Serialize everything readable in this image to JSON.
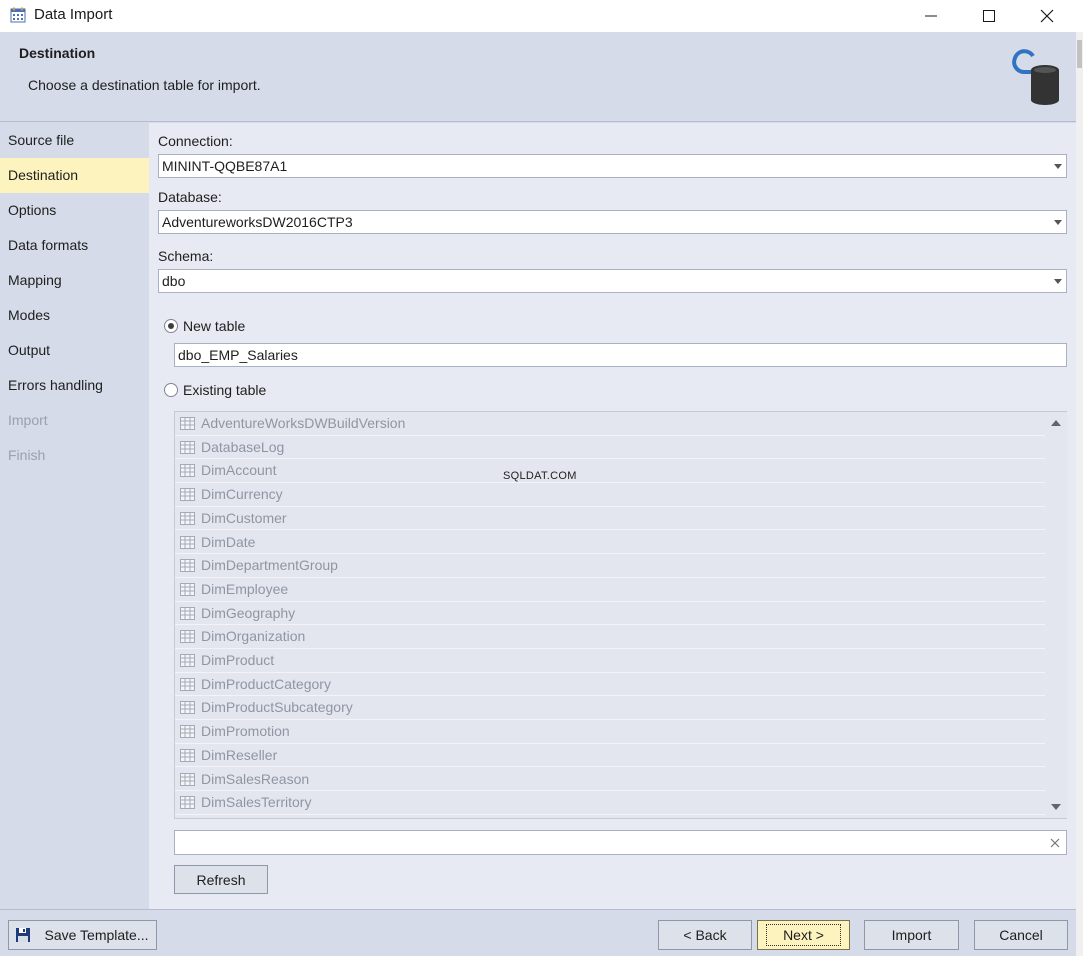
{
  "window": {
    "title": "Data Import"
  },
  "header": {
    "title": "Destination",
    "subtitle": "Choose a destination table for import."
  },
  "sidebar": {
    "items": [
      {
        "label": "Source file",
        "state": "normal"
      },
      {
        "label": "Destination",
        "state": "active"
      },
      {
        "label": "Options",
        "state": "normal"
      },
      {
        "label": "Data formats",
        "state": "normal"
      },
      {
        "label": "Mapping",
        "state": "normal"
      },
      {
        "label": "Modes",
        "state": "normal"
      },
      {
        "label": "Output",
        "state": "normal"
      },
      {
        "label": "Errors handling",
        "state": "normal"
      },
      {
        "label": "Import",
        "state": "disabled"
      },
      {
        "label": "Finish",
        "state": "disabled"
      }
    ]
  },
  "form": {
    "connection_label": "Connection:",
    "connection_value": "MININT-QQBE87A1",
    "database_label": "Database:",
    "database_value": "AdventureworksDW2016CTP3",
    "schema_label": "Schema:",
    "schema_value": "dbo",
    "new_table_label": "New table",
    "new_table_value": "dbo_EMP_Salaries",
    "existing_table_label": "Existing table",
    "search_value": "",
    "refresh_label": "Refresh"
  },
  "existing_tables": [
    "AdventureWorksDWBuildVersion",
    "DatabaseLog",
    "DimAccount",
    "DimCurrency",
    "DimCustomer",
    "DimDate",
    "DimDepartmentGroup",
    "DimEmployee",
    "DimGeography",
    "DimOrganization",
    "DimProduct",
    "DimProductCategory",
    "DimProductSubcategory",
    "DimPromotion",
    "DimReseller",
    "DimSalesReason",
    "DimSalesTerritory"
  ],
  "watermark": "SQLDAT.COM",
  "footer": {
    "save_template_label": "Save Template...",
    "back_label": "< Back",
    "next_label": "Next >",
    "import_label": "Import",
    "cancel_label": "Cancel"
  },
  "colors": {
    "active_nav": "#fdf3bf",
    "panel_bg": "#e7eaf2",
    "chrome_bg": "#d6dbe9"
  },
  "icons": {
    "app": "calendar-grid-icon",
    "header": "database-import-icon",
    "table": "table-grid-icon",
    "save": "floppy-disk-icon"
  }
}
